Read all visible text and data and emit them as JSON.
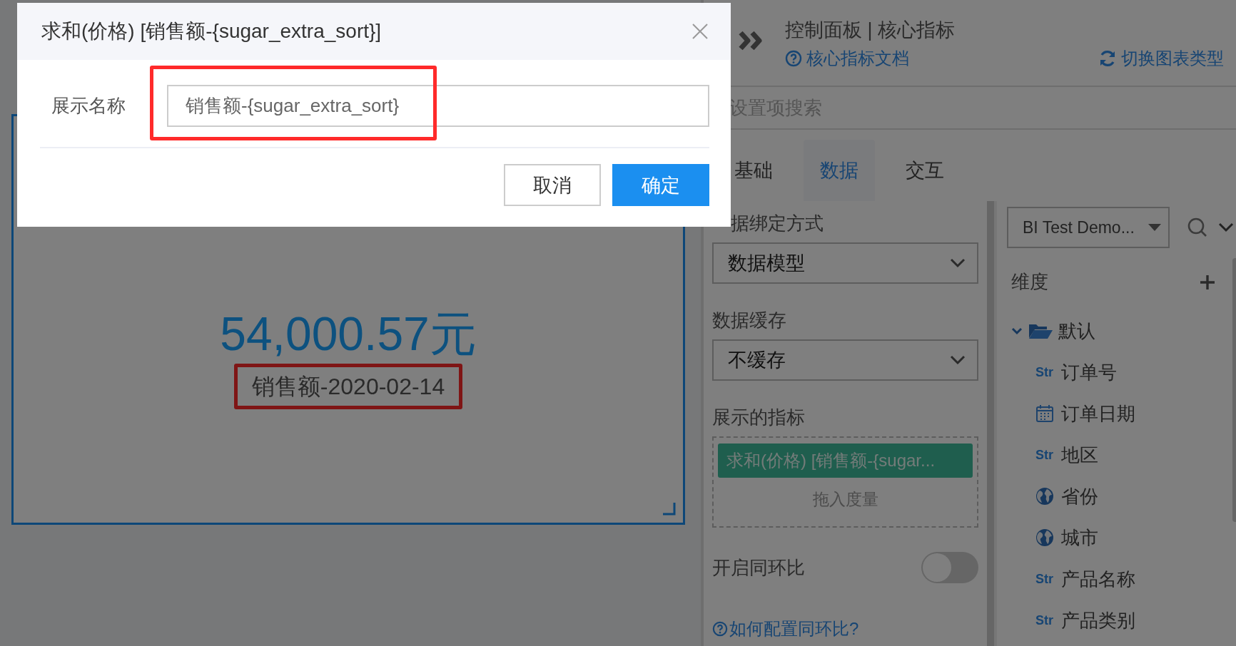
{
  "canvas": {
    "card": {
      "value": "54,000.57元",
      "subtitle": "销售额-2020-02-14"
    }
  },
  "panel": {
    "title": "控制面板 | 核心指标",
    "doc_link": "核心指标文档",
    "switch_chart": "切换图表类型",
    "search": {
      "placeholder": "设置项搜索"
    },
    "tabs": [
      {
        "label": "基础",
        "selected": false
      },
      {
        "label": "数据",
        "selected": true
      },
      {
        "label": "交互",
        "selected": false
      }
    ],
    "settings": {
      "binding": {
        "label": "据绑定方式",
        "value": "数据模型"
      },
      "cache": {
        "label": "数据缓存",
        "value": "不缓存"
      },
      "measures": {
        "label": "展示的指标",
        "chips": [
          "求和(价格) [销售额-{sugar..."
        ],
        "drop_hint": "拖入度量"
      },
      "compare": {
        "label": "开启同环比",
        "on": false
      },
      "help_link": "如何配置同环比?"
    },
    "fields": {
      "source": "BI Test Demo...",
      "dimension_label": "维度",
      "tree": [
        {
          "label": "默认",
          "expanded": true,
          "children": [
            {
              "kind": "str",
              "badge": "Str",
              "label": "订单号"
            },
            {
              "kind": "date",
              "label": "订单日期"
            },
            {
              "kind": "str",
              "badge": "Str",
              "label": "地区"
            },
            {
              "kind": "geo",
              "label": "省份"
            },
            {
              "kind": "geo",
              "label": "城市"
            },
            {
              "kind": "str",
              "badge": "Str",
              "label": "产品名称"
            },
            {
              "kind": "str",
              "badge": "Str",
              "label": "产品类别"
            }
          ]
        }
      ]
    }
  },
  "dialog": {
    "title": "求和(价格) [销售额-{sugar_extra_sort}]",
    "field_label": "展示名称",
    "field_value": "销售额-{sugar_extra_sort}",
    "buttons": [
      {
        "label": "取消",
        "kind": "secondary"
      },
      {
        "label": "确定",
        "kind": "primary"
      }
    ]
  }
}
